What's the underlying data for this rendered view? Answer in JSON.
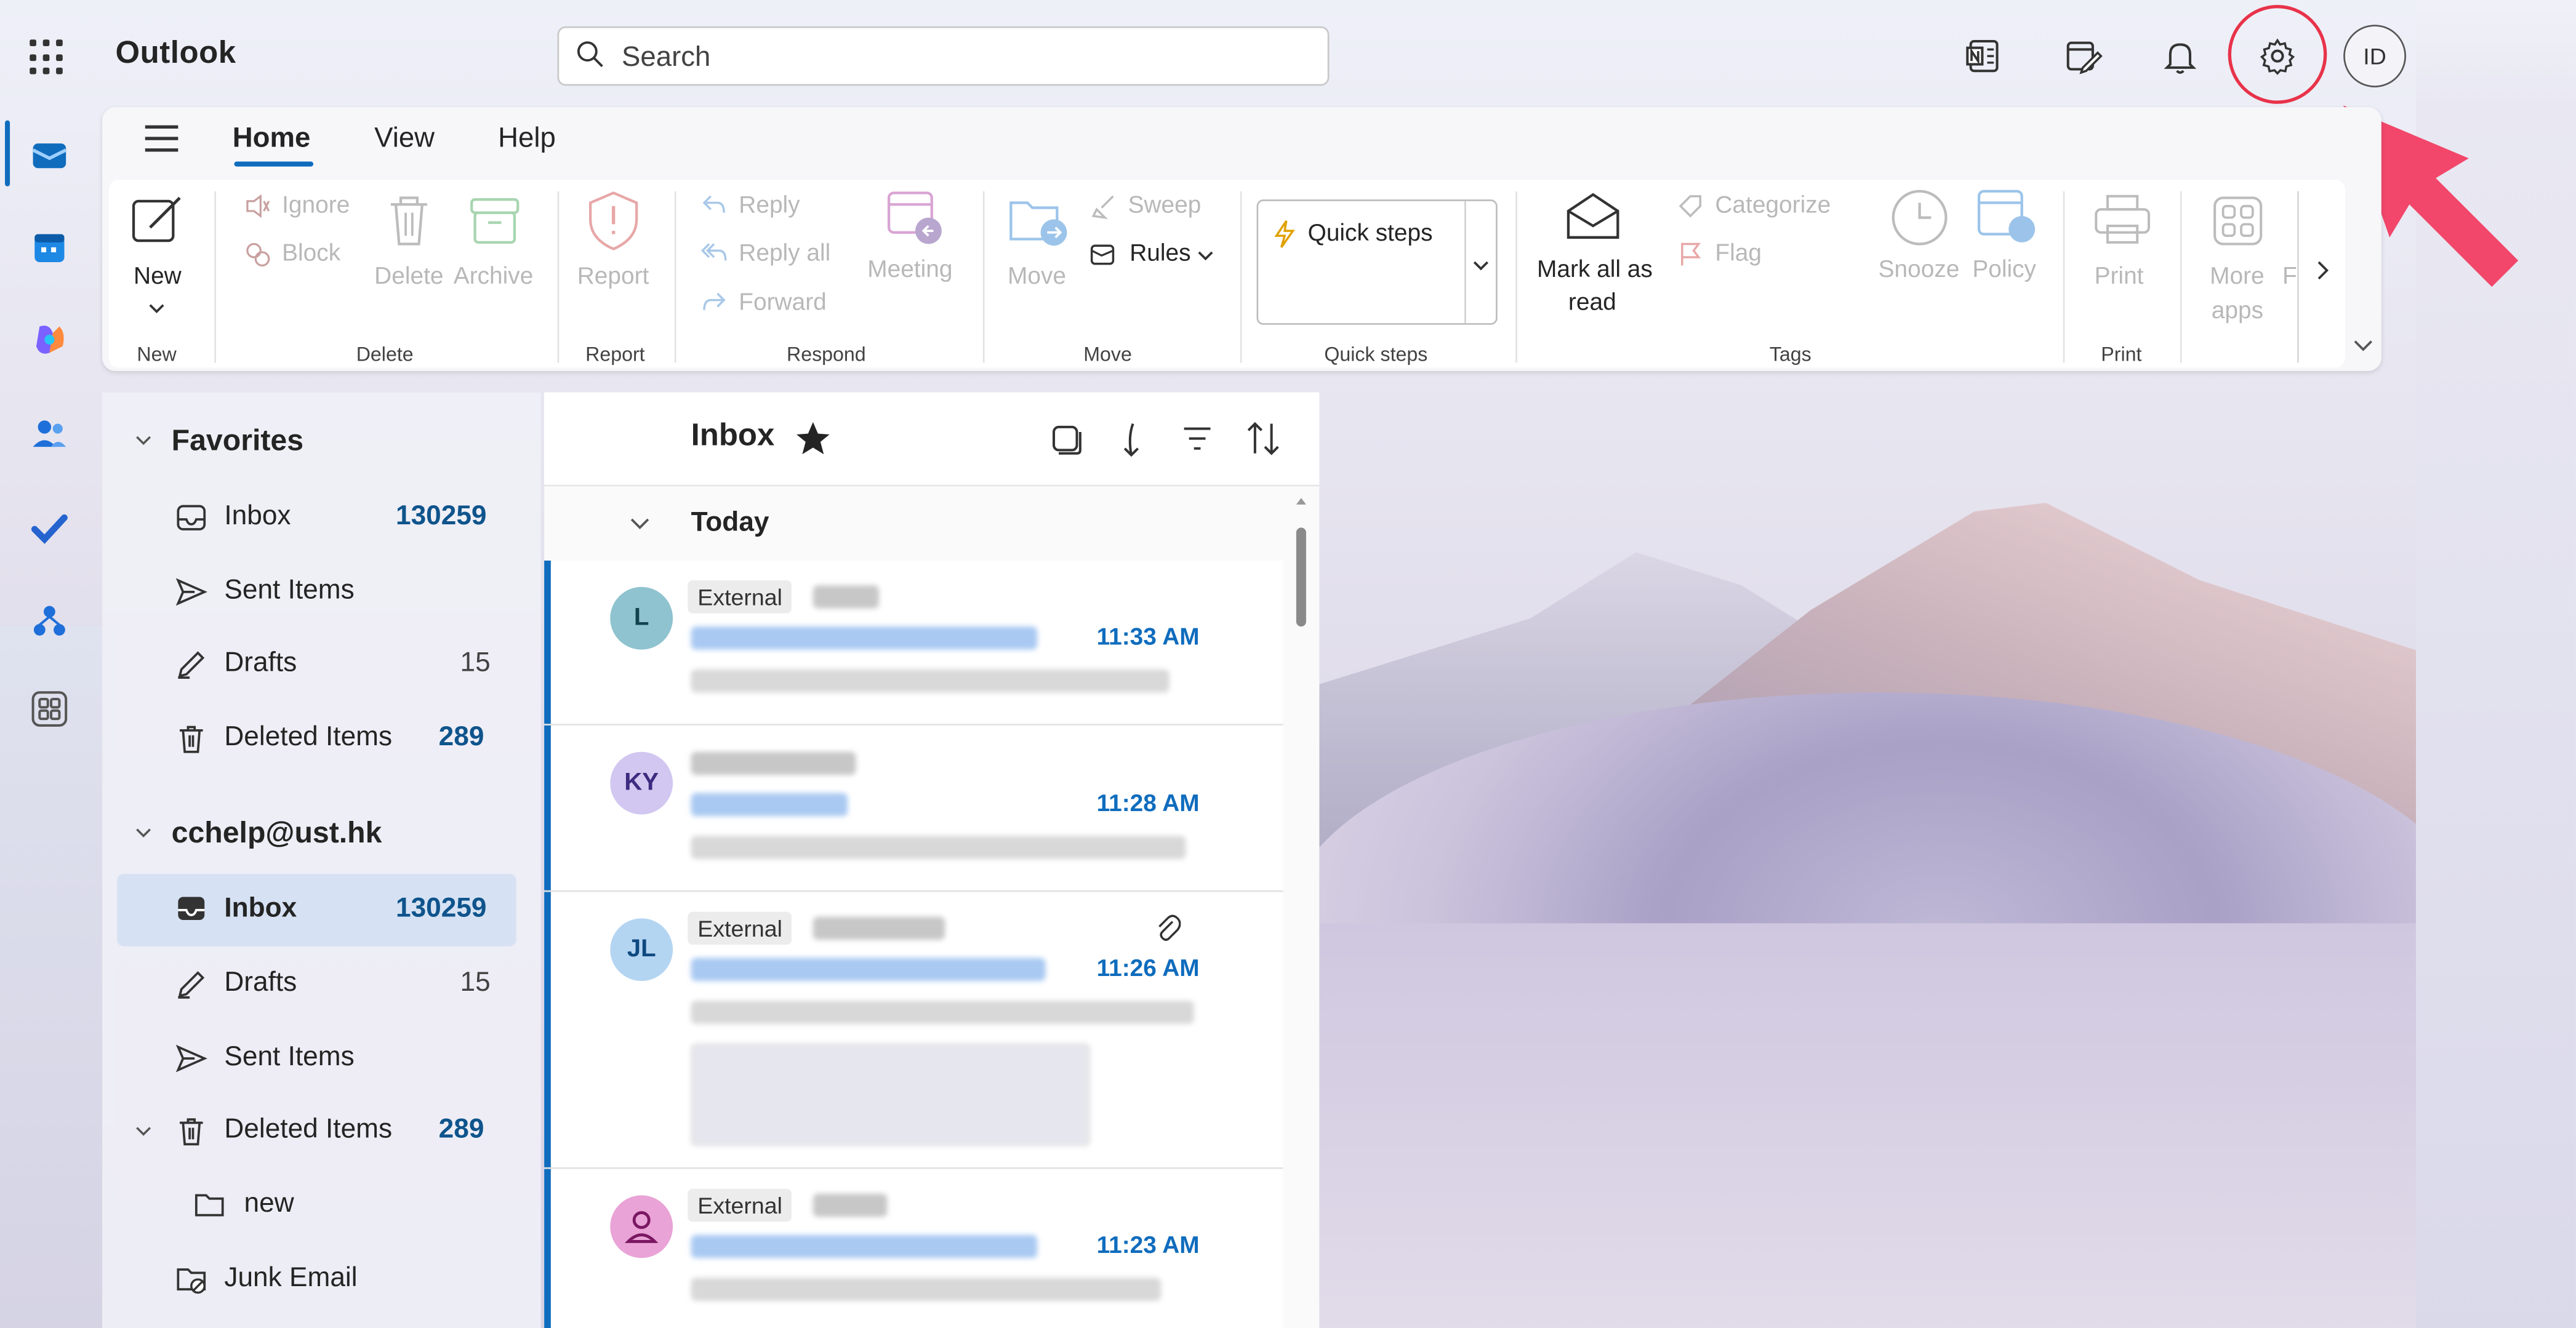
{
  "app": {
    "title": "Outlook"
  },
  "search": {
    "placeholder": "Search"
  },
  "account": {
    "initials": "ID"
  },
  "ribbon": {
    "tabs": [
      "Home",
      "View",
      "Help"
    ],
    "new_label": "New",
    "ignore": "Ignore",
    "block": "Block",
    "delete": "Delete",
    "archive": "Archive",
    "report": "Report",
    "reply": "Reply",
    "reply_all": "Reply all",
    "forward": "Forward",
    "meeting": "Meeting",
    "move": "Move",
    "sweep": "Sweep",
    "rules": "Rules",
    "quick_steps": "Quick steps",
    "mark_all_read_1": "Mark all as",
    "mark_all_read_2": "read",
    "categorize": "Categorize",
    "flag": "Flag",
    "snooze": "Snooze",
    "policy": "Policy",
    "print": "Print",
    "more_apps_1": "More",
    "more_apps_2": "apps",
    "more_apps_3": "F",
    "groups": {
      "new": "New",
      "delete": "Delete",
      "report": "Report",
      "respond": "Respond",
      "move": "Move",
      "quick_steps": "Quick steps",
      "tags": "Tags",
      "print": "Print"
    }
  },
  "folders": {
    "favorites_header": "Favorites",
    "favorites": [
      {
        "label": "Inbox",
        "count": "130259"
      },
      {
        "label": "Sent Items",
        "count": ""
      },
      {
        "label": "Drafts",
        "count": "15"
      },
      {
        "label": "Deleted Items",
        "count": "289"
      }
    ],
    "account_header": "cchelp@ust.hk",
    "account": [
      {
        "label": "Inbox",
        "count": "130259"
      },
      {
        "label": "Drafts",
        "count": "15"
      },
      {
        "label": "Sent Items",
        "count": ""
      },
      {
        "label": "Deleted Items",
        "count": "289"
      },
      {
        "label": "new",
        "count": ""
      },
      {
        "label": "Junk Email",
        "count": ""
      }
    ]
  },
  "message_list": {
    "title": "Inbox",
    "group_today": "Today",
    "messages": [
      {
        "avatar": "L",
        "tag": "External",
        "time": "11:33 AM"
      },
      {
        "avatar": "KY",
        "tag": "",
        "time": "11:28 AM"
      },
      {
        "avatar": "JL",
        "tag": "External",
        "time": "11:26 AM"
      },
      {
        "avatar": "",
        "tag": "External",
        "time": "11:23 AM"
      }
    ]
  },
  "colors": {
    "accent": "#0f6cbd",
    "highlight": "#e8334a",
    "selected": "#d6e2f3"
  }
}
